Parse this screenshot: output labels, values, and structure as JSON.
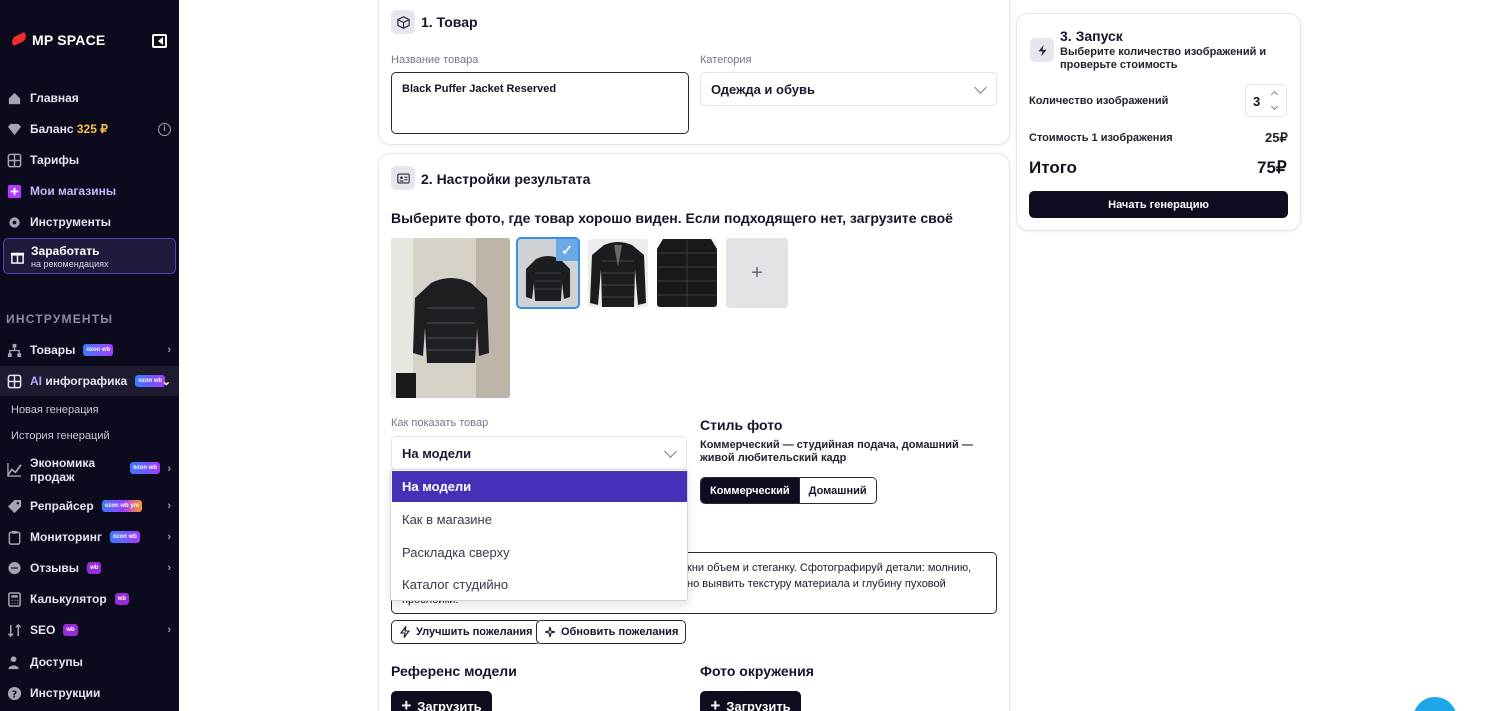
{
  "sidebar": {
    "logo_text": "MP SPACE",
    "nav": {
      "home": "Главная",
      "balance_label": "Баланс",
      "balance_amount": "325 ₽",
      "tariffs": "Тарифы",
      "my_stores": "Мои магазины",
      "tools": "Инструменты"
    },
    "earn": {
      "title": "Заработать",
      "subtitle": "на рекомендациях"
    },
    "section_title": "ИНСТРУМЕНТЫ",
    "tools": {
      "products": "Товары",
      "ai_prefix": "AI",
      "ai_label": "инфографика",
      "new_generation": "Новая генерация",
      "history": "История генераций",
      "economy_line1": "Экономика",
      "economy_line2": "продаж",
      "repricer": "Репрайсер",
      "monitoring": "Мониторинг",
      "reviews": "Отзывы",
      "calculator": "Калькулятор",
      "seo": "SEO",
      "access": "Доступы",
      "instructions": "Инструкции"
    },
    "badge_ozon_wb": "ozon wb",
    "badge_wb": "wb",
    "badge_tri": "ozon wb ym",
    "colors": {
      "bg": "#0c0b1d",
      "accent": "#5a3fb5",
      "balance": "#f6c343"
    }
  },
  "product": {
    "title": "1. Товар",
    "name_label": "Название товара",
    "name_value": "Black Puffer Jacket Reserved",
    "category_label": "Категория",
    "category_value": "Одежда и обувь"
  },
  "result": {
    "title": "2. Настройки результата",
    "photo_prompt": "Выберите фото, где товар хорошо виден. Если подходящего нет, загрузите своё",
    "add_photo": "+",
    "check": "✓",
    "show_label": "Как показать товар",
    "show_value": "На модели",
    "dropdown_options": [
      "На модели",
      "Как в магазине",
      "Раскладка сверху",
      "Каталог студийно"
    ],
    "style_title": "Стиль фото",
    "style_desc": "Коммерческий — студийная подача, домашний — живой любительский кадр",
    "style_options": [
      "Коммерческий",
      "Домашний"
    ],
    "wishes_line1": "кни объем и стеганку. Сфотографируй детали: молнию,",
    "wishes_line2": "но выявить текстуру материала и глубину пуховой",
    "wishes_line3": "прослойки.",
    "improve_btn": "Улучшить пожелания",
    "refresh_btn": "Обновить пожелания",
    "model_ref_title": "Референс модели",
    "env_photo_title": "Фото окружения",
    "upload_btn": "Загрузить"
  },
  "launch": {
    "title": "3. Запуск",
    "subtitle": "Выберите количество изображений и проверьте стоимость",
    "qty_label": "Количество изображений",
    "qty_value": "3",
    "price_label": "Стоимость 1 изображения",
    "price_value": "25₽",
    "total_label": "Итого",
    "total_value": "75₽",
    "start_btn": "Начать генерацию"
  }
}
